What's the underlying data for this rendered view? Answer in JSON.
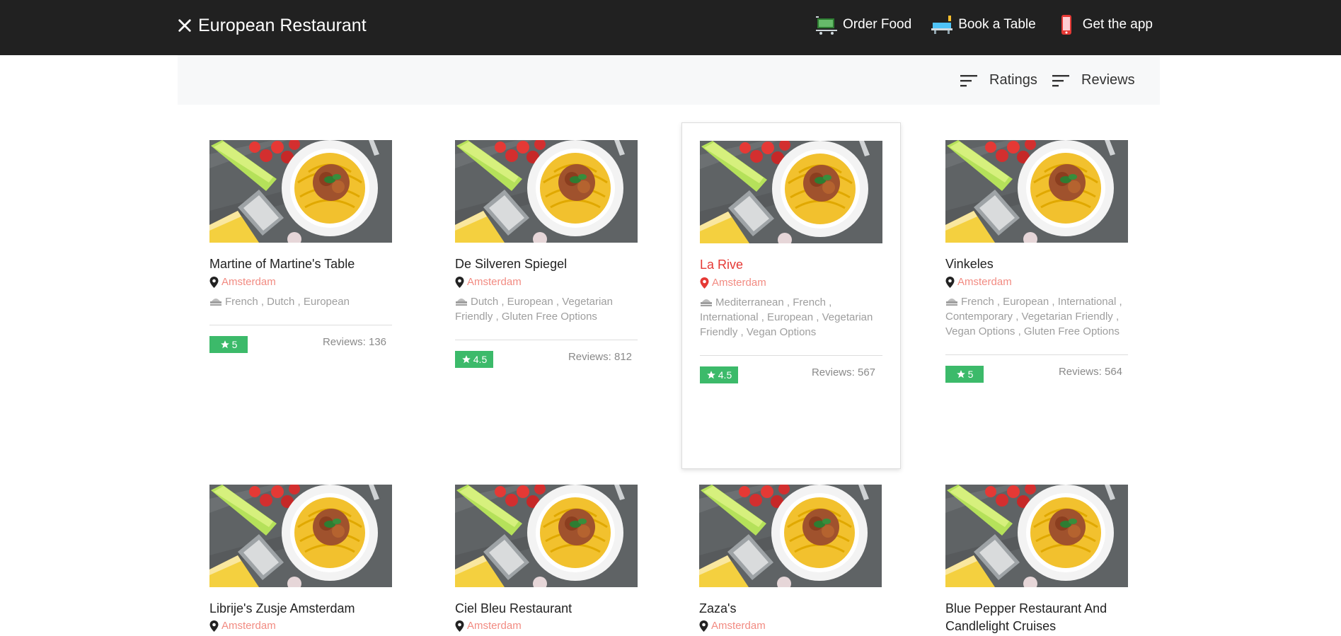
{
  "header": {
    "brand": "European Restaurant",
    "nav": [
      {
        "label": "Order Food",
        "icon": "cart-icon"
      },
      {
        "label": "Book a Table",
        "icon": "table-icon"
      },
      {
        "label": "Get the app",
        "icon": "phone-icon"
      }
    ]
  },
  "filters": {
    "ratings_label": "Ratings",
    "reviews_label": "Reviews"
  },
  "restaurants": [
    {
      "name": "Martine of Martine's Table",
      "city": "Amsterdam",
      "cuisines": "French , Dutch , European",
      "rating": "5",
      "reviews": "Reviews: 136"
    },
    {
      "name": "De Silveren Spiegel",
      "city": "Amsterdam",
      "cuisines": "Dutch , European , Vegetarian Friendly , Gluten Free Options",
      "rating": "4.5",
      "reviews": "Reviews: 812"
    },
    {
      "name": "La Rive",
      "city": "Amsterdam",
      "cuisines": "Mediterranean , French , International , European , Vegetarian Friendly , Vegan Options",
      "rating": "4.5",
      "reviews": "Reviews: 567"
    },
    {
      "name": "Vinkeles",
      "city": "Amsterdam",
      "cuisines": "French , European , International , Contemporary , Vegetarian Friendly , Vegan Options , Gluten Free Options",
      "rating": "5",
      "reviews": "Reviews: 564"
    },
    {
      "name": "Librije's Zusje Amsterdam",
      "city": "Amsterdam",
      "cuisines": "",
      "rating": "",
      "reviews": ""
    },
    {
      "name": "Ciel Bleu Restaurant",
      "city": "Amsterdam",
      "cuisines": "",
      "rating": "",
      "reviews": ""
    },
    {
      "name": "Zaza's",
      "city": "Amsterdam",
      "cuisines": "",
      "rating": "",
      "reviews": ""
    },
    {
      "name": "Blue Pepper Restaurant And Candlelight Cruises",
      "city": "",
      "cuisines": "",
      "rating": "",
      "reviews": ""
    }
  ],
  "colors": {
    "header_bg": "#212121",
    "rating_badge": "#3cba6a",
    "city_text": "#f28b82",
    "active_title": "#e53935"
  }
}
